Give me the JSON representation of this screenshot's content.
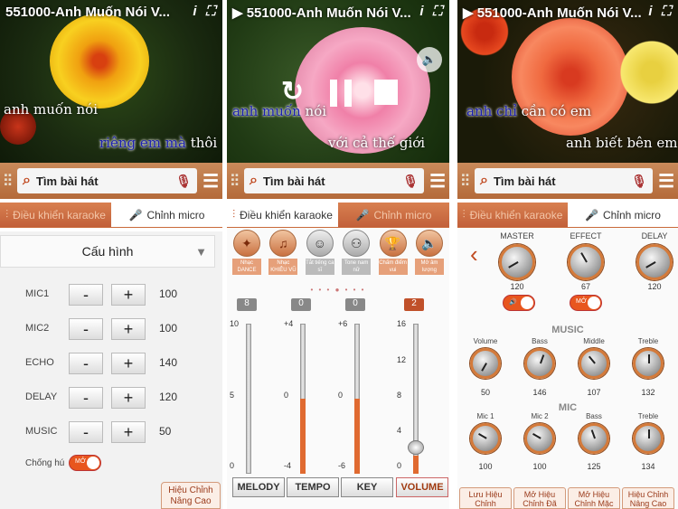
{
  "panel1": {
    "title": "551000-Anh Muốn Nói V...",
    "lyric1": "anh muốn nói",
    "lyric2_hl": "riêng em mà",
    "lyric2_rest": " thôi",
    "search_placeholder": "Tìm bài hát",
    "tab_control": "Điều khiển karaoke",
    "tab_mic": "Chỉnh micro",
    "config": "Cấu hình",
    "rows": [
      {
        "label": "MIC1",
        "minus": "-",
        "plus": "+",
        "value": "100"
      },
      {
        "label": "MIC2",
        "minus": "-",
        "plus": "+",
        "value": "100"
      },
      {
        "label": "ECHO",
        "minus": "-",
        "plus": "+",
        "value": "140"
      },
      {
        "label": "DELAY",
        "minus": "-",
        "plus": "+",
        "value": "120"
      },
      {
        "label": "MUSIC",
        "minus": "-",
        "plus": "+",
        "value": "50"
      }
    ],
    "anti_howl": "Chống hú",
    "toggle": "MỞ",
    "corner_line1": "Hiệu Chỉnh",
    "corner_line2": "Nâng Cao"
  },
  "panel2": {
    "title": "551000-Anh Muốn Nói V...",
    "lyric1_hl": "anh muốn",
    "lyric1_rest": " nói",
    "lyric2": "với cả thế giới",
    "search_placeholder": "Tìm bài hát",
    "tab_control": "Điều khiển karaoke",
    "tab_mic": "Chỉnh micro",
    "functions": [
      {
        "label": "Nhạc DANCE",
        "icon": "dance-icon"
      },
      {
        "label": "Nhạc KHIÊU VŨ",
        "icon": "couple-dance-icon"
      },
      {
        "label": "Tắt tiếng ca sĩ",
        "icon": "singer-mute-icon"
      },
      {
        "label": "Tone nam nữ",
        "icon": "tone-icon"
      },
      {
        "label": "Chấm điểm vui",
        "icon": "trophy-icon"
      },
      {
        "label": "Mở âm lượng",
        "icon": "speaker-icon"
      }
    ],
    "sliders": [
      {
        "name": "MELODY",
        "badge": "8",
        "top": "10",
        "mid": "5",
        "bottom": "0",
        "level": 0
      },
      {
        "name": "TEMPO",
        "badge": "0",
        "top": "+4",
        "mid": "0",
        "bottom": "-4",
        "level": 0.5
      },
      {
        "name": "KEY",
        "badge": "0",
        "top": "+6",
        "mid": "0",
        "bottom": "-6",
        "level": 0.5
      },
      {
        "name": "VOLUME",
        "badge": "2",
        "top": "16",
        "mid": "8",
        "bottom": "0",
        "level": 0.125,
        "ticks": [
          "16",
          "12",
          "8",
          "4",
          "0"
        ]
      }
    ]
  },
  "panel3": {
    "title": "551000-Anh Muốn Nói V...",
    "lyric1_hl": "anh chỉ",
    "lyric1_rest": " cần có em",
    "lyric2": "anh biết bên em",
    "search_placeholder": "Tìm bài hát",
    "tab_control": "Điều khiển karaoke",
    "tab_mic": "Chỉnh micro",
    "top_knobs": [
      {
        "label": "MASTER",
        "value": "120"
      },
      {
        "label": "EFFECT",
        "value": "67"
      },
      {
        "label": "DELAY",
        "value": "120"
      }
    ],
    "toggle": "MỞ",
    "music_label": "MUSIC",
    "music_knobs": [
      {
        "label": "Volume",
        "value": "50"
      },
      {
        "label": "Bass",
        "value": "146"
      },
      {
        "label": "Middle",
        "value": "107"
      },
      {
        "label": "Treble",
        "value": "132"
      }
    ],
    "mic_label": "MIC",
    "mic_knobs": [
      {
        "label": "Mic 1",
        "value": "100"
      },
      {
        "label": "Mic 2",
        "value": "100"
      },
      {
        "label": "Bass",
        "value": "125"
      },
      {
        "label": "Treble",
        "value": "134"
      }
    ],
    "bottom_buttons": [
      "Lưu Hiệu Chỉnh",
      "Mở Hiệu Chỉnh Đã Lưu",
      "Mở Hiệu Chỉnh Mặc Định",
      "Hiệu Chỉnh Nâng Cao"
    ]
  },
  "colors": {
    "accent": "#c96a3a",
    "highlight": "#1b1fb0",
    "toggle": "#e8561e"
  }
}
